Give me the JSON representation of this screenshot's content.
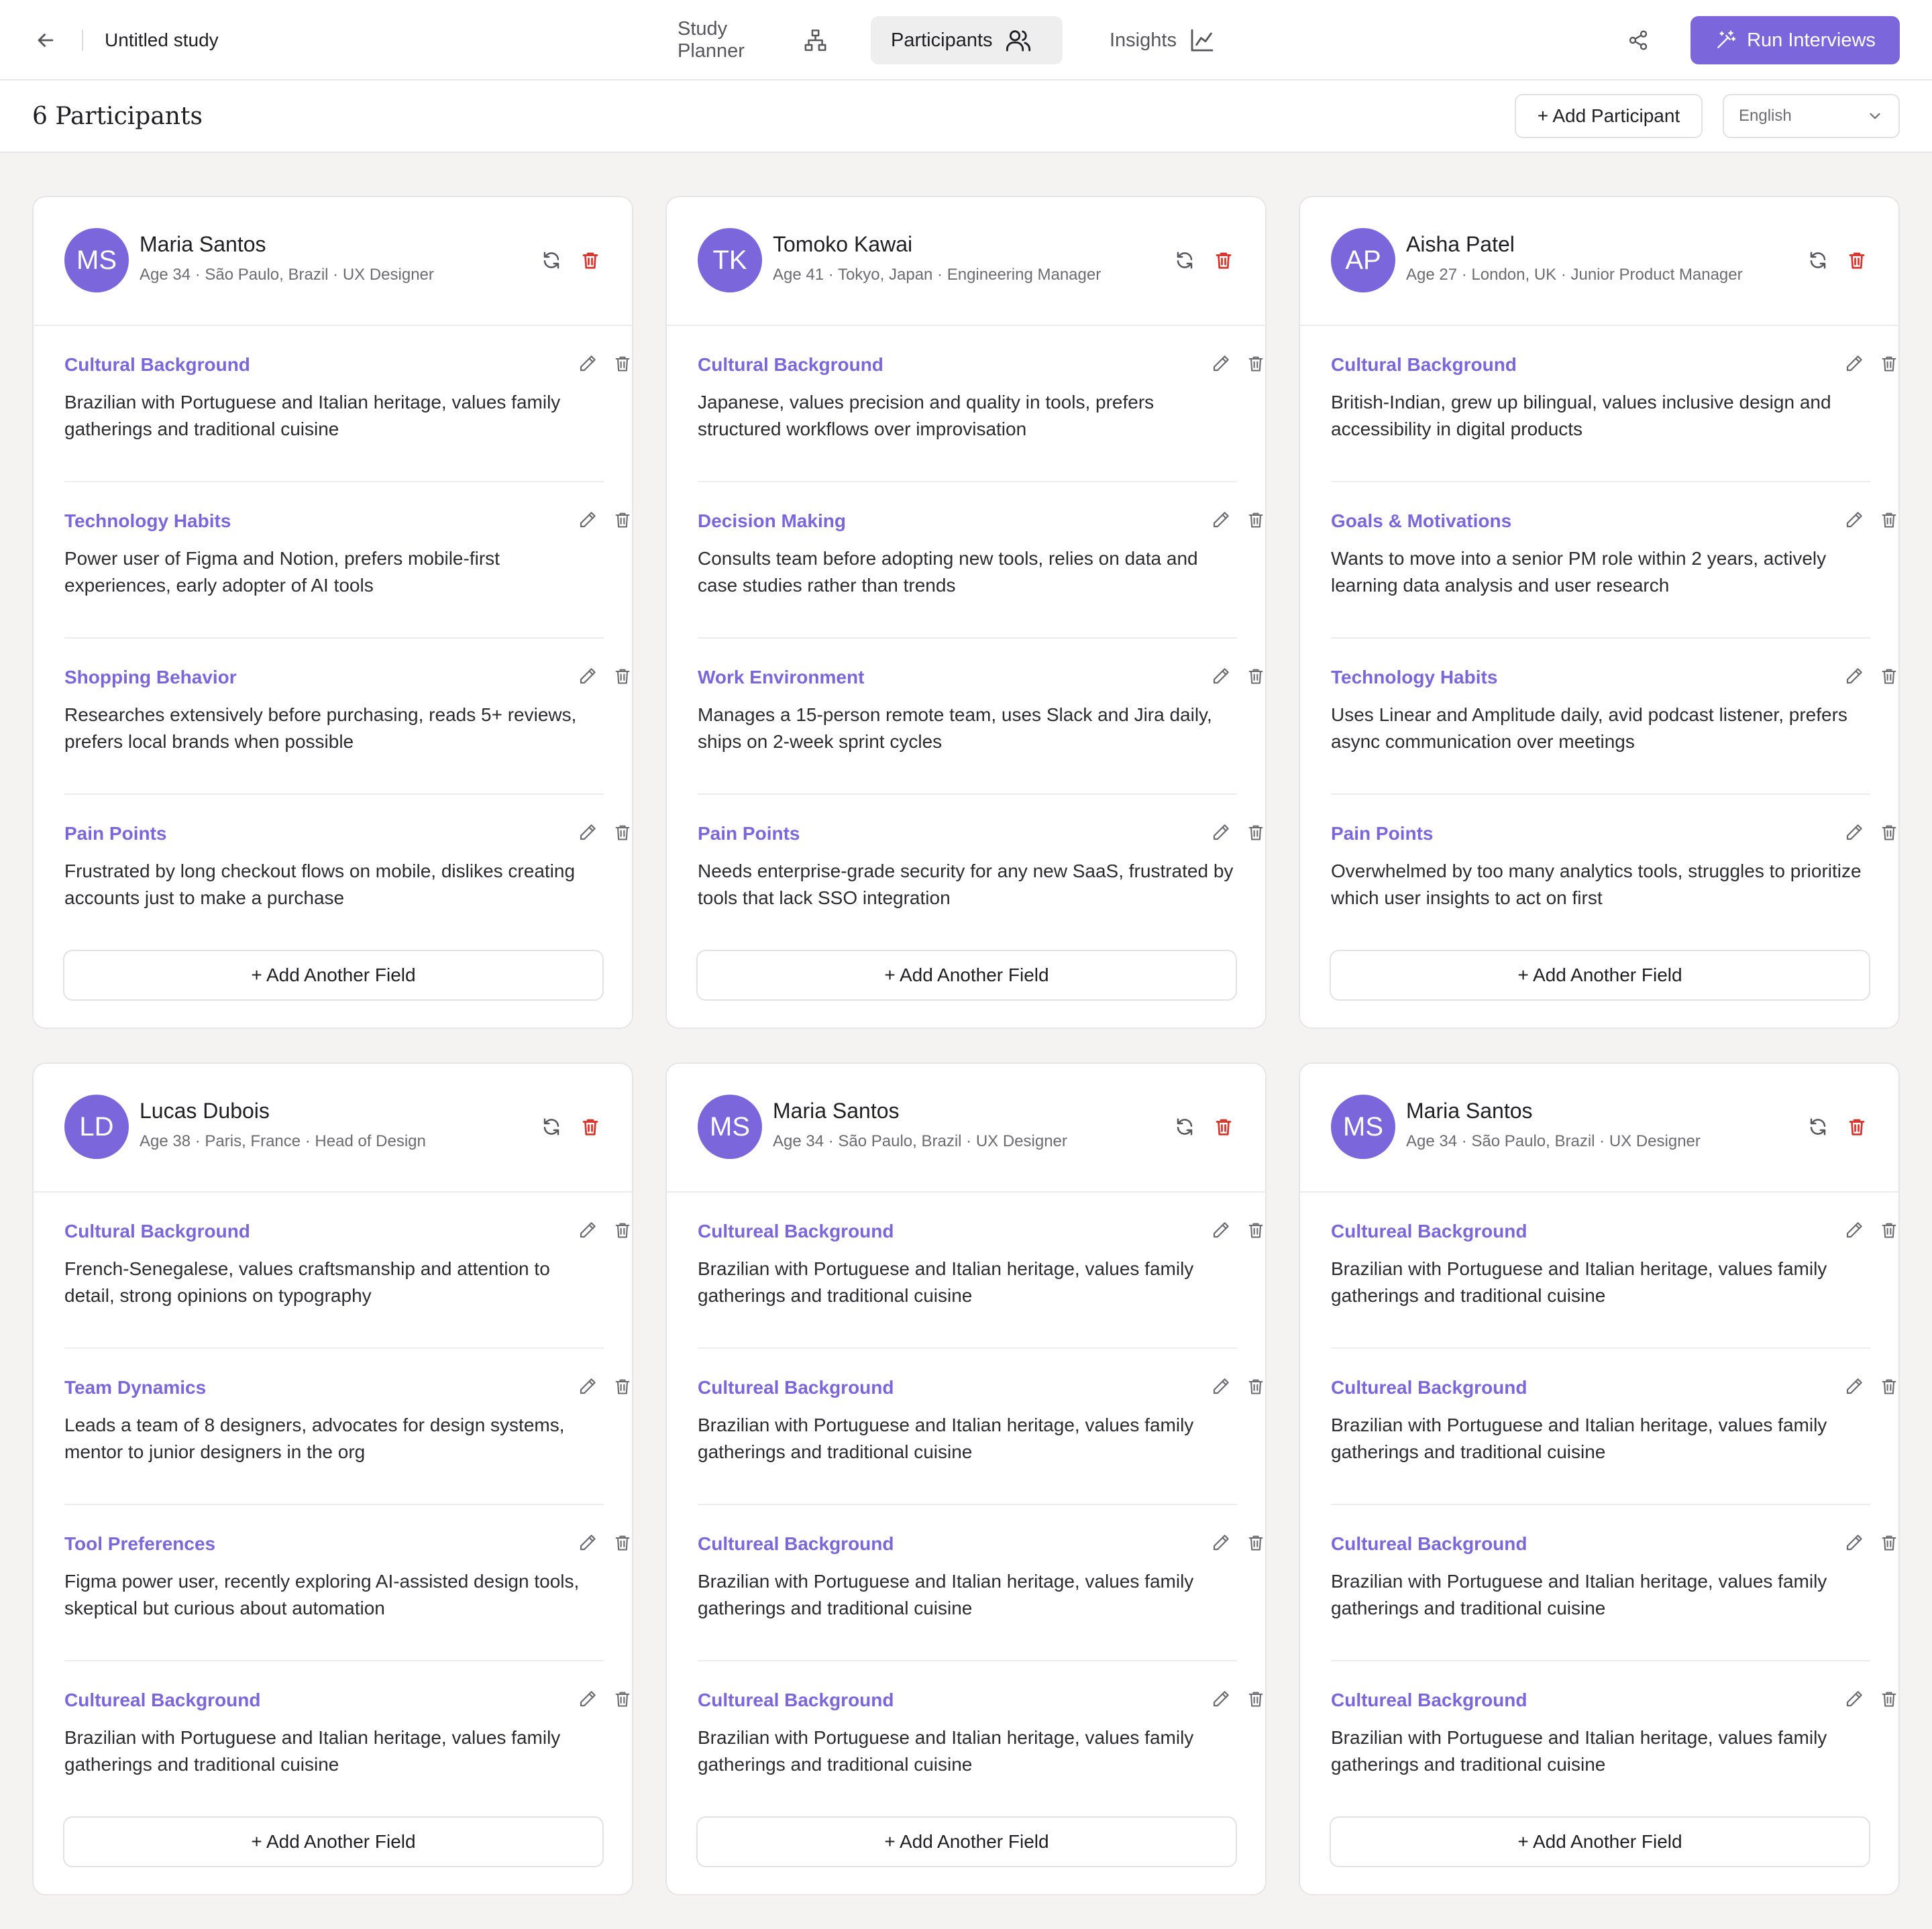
{
  "header": {
    "study_title": "Untitled study",
    "tabs": [
      {
        "label": "Study Planner",
        "icon": "flow-diagram-icon"
      },
      {
        "label": "Participants",
        "icon": "users-icon",
        "active": true
      },
      {
        "label": "Insights",
        "icon": "line-chart-icon"
      }
    ],
    "run_label": "Run Interviews",
    "accent_color": "#7c66dc"
  },
  "subheader": {
    "title": "6 Participants",
    "add_participant_label": "+ Add Participant",
    "language": "English"
  },
  "add_field_label": "+ Add Another Field",
  "participants": [
    {
      "initials": "MS",
      "name": "Maria Santos",
      "meta": "Age 34 · São Paulo, Brazil · UX Designer",
      "fields": [
        {
          "label": "Cultural Background",
          "value": "Brazilian with Portuguese and Italian heritage, values family gatherings and traditional cuisine"
        },
        {
          "label": "Technology Habits",
          "value": "Power user of Figma and Notion, prefers mobile-first experiences, early adopter of AI tools"
        },
        {
          "label": "Shopping Behavior",
          "value": "Researches extensively before purchasing, reads 5+ reviews, prefers local brands when possible"
        },
        {
          "label": "Pain Points",
          "value": "Frustrated by long checkout flows on mobile, dislikes creating accounts just to make a purchase"
        }
      ]
    },
    {
      "initials": "TK",
      "name": "Tomoko Kawai",
      "meta": "Age 41 · Tokyo, Japan · Engineering Manager",
      "fields": [
        {
          "label": "Cultural Background",
          "value": "Japanese, values precision and quality in tools, prefers structured workflows over improvisation"
        },
        {
          "label": "Decision Making",
          "value": "Consults team before adopting new tools, relies on data and case studies rather than trends"
        },
        {
          "label": "Work Environment",
          "value": "Manages a 15-person remote team, uses Slack and Jira daily, ships on 2-week sprint cycles"
        },
        {
          "label": "Pain Points",
          "value": "Needs enterprise-grade security for any new SaaS, frustrated by tools that lack SSO integration"
        }
      ]
    },
    {
      "initials": "AP",
      "name": "Aisha Patel",
      "meta": "Age 27 · London, UK · Junior Product Manager",
      "fields": [
        {
          "label": "Cultural Background",
          "value": "British-Indian, grew up bilingual, values inclusive design and accessibility in digital products"
        },
        {
          "label": "Goals & Motivations",
          "value": "Wants to move into a senior PM role within 2 years, actively learning data analysis and user research"
        },
        {
          "label": "Technology Habits",
          "value": "Uses Linear and Amplitude daily, avid podcast listener, prefers async communication over meetings"
        },
        {
          "label": "Pain Points",
          "value": "Overwhelmed by too many analytics tools, struggles to prioritize which user insights to act on first"
        }
      ]
    },
    {
      "initials": "LD",
      "name": "Lucas Dubois",
      "meta": "Age 38 · Paris, France · Head of Design",
      "fields": [
        {
          "label": "Cultural Background",
          "value": "French-Senegalese, values craftsmanship and attention to detail, strong opinions on typography"
        },
        {
          "label": "Team Dynamics",
          "value": "Leads a team of 8 designers, advocates for design systems, mentor to junior designers in the org"
        },
        {
          "label": "Tool Preferences",
          "value": "Figma power user, recently exploring AI-assisted design tools, skeptical but curious about automation"
        },
        {
          "label": "Cultureal Background",
          "value": "Brazilian with Portuguese and Italian heritage, values family gatherings and traditional cuisine"
        }
      ]
    },
    {
      "initials": "MS",
      "name": "Maria Santos",
      "meta": "Age 34 · São Paulo, Brazil · UX Designer",
      "fields": [
        {
          "label": "Cultureal Background",
          "value": "Brazilian with Portuguese and Italian heritage, values family gatherings and traditional cuisine"
        },
        {
          "label": "Cultureal Background",
          "value": "Brazilian with Portuguese and Italian heritage, values family gatherings and traditional cuisine"
        },
        {
          "label": "Cultureal Background",
          "value": "Brazilian with Portuguese and Italian heritage, values family gatherings and traditional cuisine"
        },
        {
          "label": "Cultureal Background",
          "value": "Brazilian with Portuguese and Italian heritage, values family gatherings and traditional cuisine"
        }
      ]
    },
    {
      "initials": "MS",
      "name": "Maria Santos",
      "meta": "Age 34 · São Paulo, Brazil · UX Designer",
      "fields": [
        {
          "label": "Cultureal Background",
          "value": "Brazilian with Portuguese and Italian heritage, values family gatherings and traditional cuisine"
        },
        {
          "label": "Cultureal Background",
          "value": "Brazilian with Portuguese and Italian heritage, values family gatherings and traditional cuisine"
        },
        {
          "label": "Cultureal Background",
          "value": "Brazilian with Portuguese and Italian heritage, values family gatherings and traditional cuisine"
        },
        {
          "label": "Cultureal Background",
          "value": "Brazilian with Portuguese and Italian heritage, values family gatherings and traditional cuisine"
        }
      ]
    }
  ]
}
